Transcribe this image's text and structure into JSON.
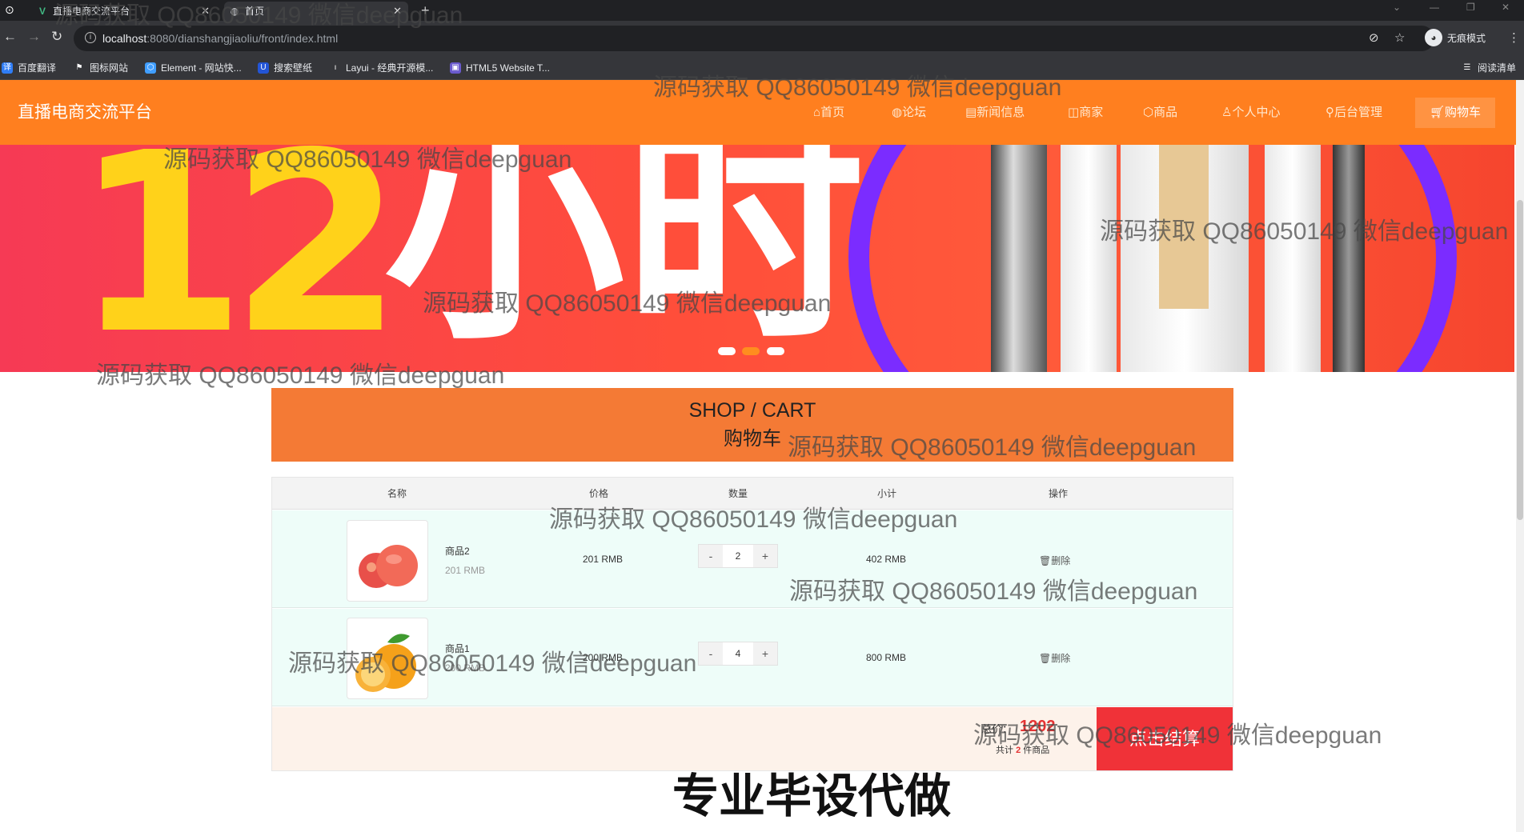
{
  "browser": {
    "tabs": [
      {
        "title": "直播电商交流平台"
      },
      {
        "title": "首页"
      }
    ],
    "url_host": "localhost",
    "url_path": ":8080/dianshangjiaoliu/front/index.html",
    "profile_label": "无痕模式",
    "bookmarks": [
      "百度翻译",
      "图标网站",
      "Element - 网站快...",
      "搜索壁纸",
      "Layui - 经典开源模...",
      "HTML5 Website T..."
    ],
    "reading_list": "阅读清单"
  },
  "site": {
    "title": "直播电商交流平台",
    "nav": [
      "首页",
      "论坛",
      "新闻信息",
      "商家",
      "商品",
      "个人中心",
      "后台管理"
    ],
    "nav_cart": "购物车",
    "banner_text": {
      "number": "12",
      "word": "小时"
    },
    "carousel_active": 2,
    "carousel_total": 3
  },
  "cart": {
    "heading_en": "SHOP / CART",
    "heading_cn": "购物车",
    "columns": [
      "名称",
      "价格",
      "数量",
      "小计",
      "操作"
    ],
    "items": [
      {
        "name": "商品2",
        "sub_price": "201 RMB",
        "price": "201 RMB",
        "qty": "2",
        "subtotal": "402 RMB",
        "delete": "删除",
        "image": "apple"
      },
      {
        "name": "商品1",
        "sub_price": "200 RMB",
        "price": "200 RMB",
        "qty": "4",
        "subtotal": "800 RMB",
        "delete": "删除",
        "image": "orange"
      }
    ],
    "qty_minus": "-",
    "qty_plus": "+",
    "total_label": "总价：",
    "total_value": "1202",
    "count_prefix": "共计",
    "count_value": "2",
    "count_suffix": "件商品",
    "checkout": "点击结算"
  },
  "overlay": {
    "watermark": "源码获取 QQ86050149 微信deepguan",
    "slogan": "专业毕设代做"
  },
  "colors": {
    "brand_orange": "#ff7f1f",
    "checkout_red": "#f03238",
    "total_red": "#e53333"
  }
}
